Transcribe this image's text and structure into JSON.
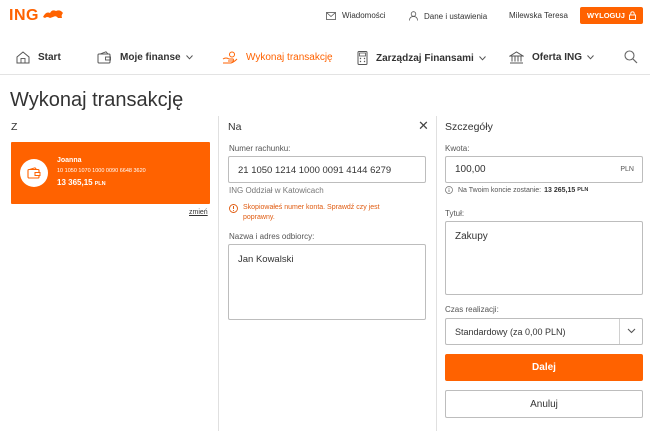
{
  "header": {
    "logo_text": "ING",
    "messages_label": "Wiadomości",
    "settings_label": "Dane i ustawienia",
    "user_name": "Milewska Teresa",
    "logout_label": "WYLOGUJ"
  },
  "nav": {
    "items": [
      {
        "label": "Start",
        "icon": "home-icon"
      },
      {
        "label": "Moje finanse",
        "icon": "wallet-icon"
      },
      {
        "label": "Wykonaj transakcję",
        "icon": "transfer-hand-icon",
        "active": true
      },
      {
        "label": "Zarządzaj Finansami",
        "icon": "calculator-icon"
      },
      {
        "label": "Oferta ING",
        "icon": "bank-icon"
      }
    ]
  },
  "page": {
    "title": "Wykonaj transakcję"
  },
  "from": {
    "heading": "Z",
    "account_name": "Joanna",
    "account_number": "10 1050 1070 1000 0090 6648 3620",
    "balance": "13 365,15",
    "currency": "PLN",
    "change_label": "zmień"
  },
  "to": {
    "heading": "Na",
    "account_label": "Numer rachunku:",
    "account_value": "21 1050 1214 1000 0091 4144 6279",
    "bank_name": "ING Oddział w Katowicach",
    "error_message": "Skopiowałeś numer konta. Sprawdź czy jest poprawny.",
    "recipient_label": "Nazwa i adres odbiorcy:",
    "recipient_value": "Jan Kowalski"
  },
  "details": {
    "heading": "Szczegóły",
    "amount_label": "Kwota:",
    "amount_value": "100,00",
    "amount_currency": "PLN",
    "remaining_label": "Na Twoim koncie zostanie:",
    "remaining_value": "13 265,15",
    "remaining_currency": "PLN",
    "title_label": "Tytuł:",
    "title_value": "Zakupy",
    "timing_label": "Czas realizacji:",
    "timing_value": "Standardowy (za 0,00 PLN)",
    "next_label": "Dalej",
    "cancel_label": "Anuluj"
  },
  "colors": {
    "brand": "#ff6200",
    "error": "#e05b10"
  }
}
